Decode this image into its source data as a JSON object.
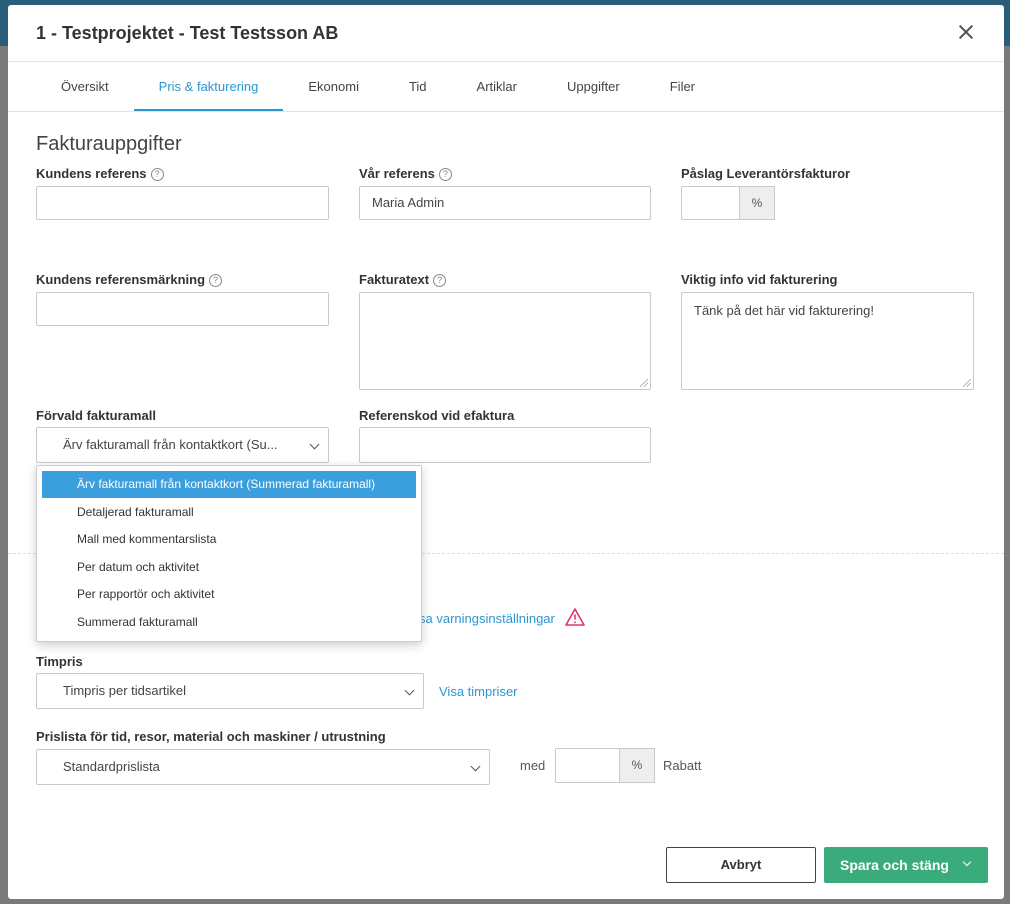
{
  "modal": {
    "title": "1 - Testprojektet - Test Testsson AB"
  },
  "tabs": [
    {
      "label": "Översikt"
    },
    {
      "label": "Pris & fakturering",
      "active": true
    },
    {
      "label": "Ekonomi"
    },
    {
      "label": "Tid"
    },
    {
      "label": "Artiklar"
    },
    {
      "label": "Uppgifter"
    },
    {
      "label": "Filer"
    }
  ],
  "section": {
    "title": "Fakturauppgifter"
  },
  "fields": {
    "kundens_referens": {
      "label": "Kundens referens",
      "value": ""
    },
    "var_referens": {
      "label": "Vår referens",
      "value": "Maria Admin"
    },
    "paslag": {
      "label": "Påslag Leverantörsfakturor",
      "value": "",
      "unit": "%"
    },
    "referensmarkning": {
      "label": "Kundens referensmärkning",
      "value": ""
    },
    "fakturatext": {
      "label": "Fakturatext",
      "value": ""
    },
    "viktig_info": {
      "label": "Viktig info vid fakturering",
      "value": "Tänk på det här vid fakturering!"
    },
    "forvald_fakturamall": {
      "label": "Förvald fakturamall",
      "value": "Ärv fakturamall från kontaktkort (Su..."
    },
    "referenskod": {
      "label": "Referenskod vid efaktura",
      "value": ""
    },
    "timpris": {
      "label": "Timpris",
      "value": "Timpris per tidsartikel",
      "link": "Visa timpriser"
    },
    "prislista": {
      "label": "Prislista för tid, resor, material och maskiner / utrustning",
      "value": "Standardprislista",
      "med": "med",
      "discount_value": "",
      "discount_unit": "%",
      "rabatt": "Rabatt"
    }
  },
  "warning_link": "sa varningsinställningar",
  "dropdown_options": [
    {
      "label": "Ärv fakturamall från kontaktkort (Summerad fakturamall)",
      "selected": true
    },
    {
      "label": "Detaljerad fakturamall"
    },
    {
      "label": "Mall med kommentarslista"
    },
    {
      "label": "Per datum och aktivitet"
    },
    {
      "label": "Per rapportör och aktivitet"
    },
    {
      "label": "Summerad fakturamall"
    }
  ],
  "footer": {
    "cancel": "Avbryt",
    "save": "Spara och stäng"
  },
  "colors": {
    "accent": "#2b97d2",
    "save_button": "#3aab7b",
    "selected_option": "#3b9fde",
    "warning": "#e0336b"
  }
}
